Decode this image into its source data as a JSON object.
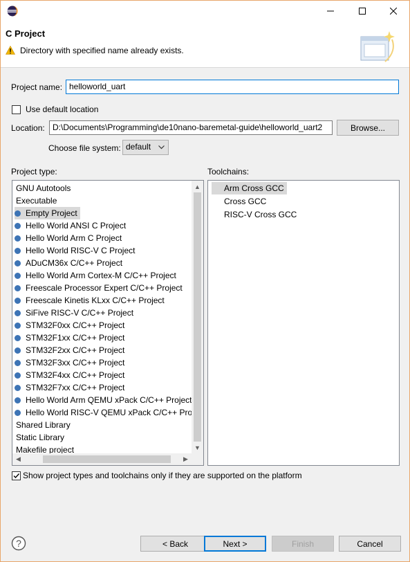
{
  "window": {
    "title": ""
  },
  "banner": {
    "title": "C Project",
    "message": "Directory with specified name already exists."
  },
  "form": {
    "project_name_label": "Project name:",
    "project_name_value": "helloworld_uart",
    "use_default_location_label": "Use default location",
    "use_default_location_checked": false,
    "location_label": "Location:",
    "location_value": "D:\\Documents\\Programming\\de10nano-baremetal-guide\\helloworld_uart2",
    "browse_label": "Browse...",
    "file_system_label": "Choose file system:",
    "file_system_value": "default"
  },
  "project_types": {
    "label": "Project type:",
    "items": [
      {
        "label": "GNU Autotools",
        "bullet": false
      },
      {
        "label": "Executable",
        "bullet": false
      },
      {
        "label": "Empty Project",
        "bullet": true,
        "selected": true
      },
      {
        "label": "Hello World ANSI C Project",
        "bullet": true
      },
      {
        "label": "Hello World Arm C Project",
        "bullet": true
      },
      {
        "label": "Hello World RISC-V C Project",
        "bullet": true
      },
      {
        "label": "ADuCM36x C/C++ Project",
        "bullet": true
      },
      {
        "label": "Hello World Arm Cortex-M C/C++ Project",
        "bullet": true
      },
      {
        "label": "Freescale Processor Expert C/C++ Project",
        "bullet": true
      },
      {
        "label": "Freescale Kinetis KLxx C/C++ Project",
        "bullet": true
      },
      {
        "label": "SiFive RISC-V C/C++ Project",
        "bullet": true
      },
      {
        "label": "STM32F0xx C/C++ Project",
        "bullet": true
      },
      {
        "label": "STM32F1xx C/C++ Project",
        "bullet": true
      },
      {
        "label": "STM32F2xx C/C++ Project",
        "bullet": true
      },
      {
        "label": "STM32F3xx C/C++ Project",
        "bullet": true
      },
      {
        "label": "STM32F4xx C/C++ Project",
        "bullet": true
      },
      {
        "label": "STM32F7xx C/C++ Project",
        "bullet": true
      },
      {
        "label": "Hello World Arm QEMU xPack C/C++ Project",
        "bullet": true
      },
      {
        "label": "Hello World RISC-V QEMU xPack C/C++ Proj",
        "bullet": true
      },
      {
        "label": "Shared Library",
        "bullet": false
      },
      {
        "label": "Static Library",
        "bullet": false
      },
      {
        "label": "Makefile project",
        "bullet": false
      }
    ]
  },
  "toolchains": {
    "label": "Toolchains:",
    "items": [
      {
        "label": "Arm Cross GCC",
        "selected": true
      },
      {
        "label": "Cross GCC"
      },
      {
        "label": "RISC-V Cross GCC"
      }
    ]
  },
  "filter": {
    "label": "Show project types and toolchains only if they are supported on the platform",
    "checked": true
  },
  "footer": {
    "help_icon": "question-icon",
    "back_label": "< Back",
    "next_label": "Next >",
    "finish_label": "Finish",
    "cancel_label": "Cancel"
  },
  "colors": {
    "accent": "#0078d7",
    "bullet": "#3d74b5",
    "warning": "#f2b705",
    "window_border": "#e8a66a"
  }
}
